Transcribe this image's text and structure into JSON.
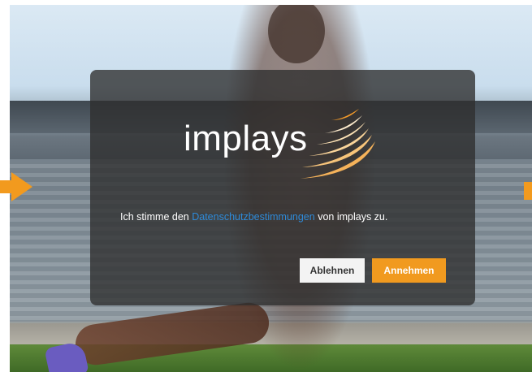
{
  "logo": {
    "text": "implays"
  },
  "consent": {
    "text_before": "Ich stimme den ",
    "link_text": "Datenschutzbestimmungen",
    "text_after": " von implays zu."
  },
  "buttons": {
    "decline_label": "Ablehnen",
    "accept_label": "Annehmen"
  },
  "colors": {
    "accent": "#f19a1f",
    "link": "#2e8ad8",
    "dialog_bg": "rgba(46,46,46,0.78)"
  },
  "icons": {
    "carousel_prev": "arrow-right-icon",
    "carousel_next": "arrow-next-icon"
  }
}
